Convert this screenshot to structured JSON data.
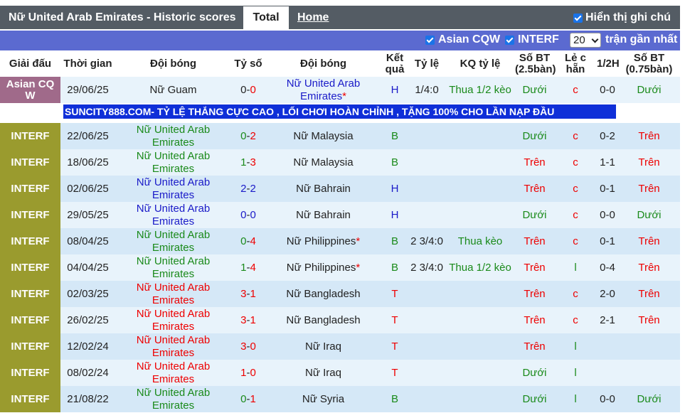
{
  "header": {
    "title": "Nữ United Arab Emirates - Historic scores",
    "tab_total": "Total",
    "tab_home": "Home",
    "show_note_label": "Hiển thị ghi chú"
  },
  "filters": {
    "asian_label": "Asian CQW",
    "interf_label": "INTERF",
    "count_value": "20",
    "count_suffix": "trận gần nhất"
  },
  "columns": [
    "Giải đấu",
    "Thời gian",
    "Đội bóng",
    "Tỷ số",
    "Đội bóng",
    "Kết quả",
    "Tỷ lệ",
    "KQ tỷ lệ",
    "Số BT (2.5bàn)",
    "Lẻ c hẵn",
    "1/2H",
    "Số BT (0.75bàn)"
  ],
  "ad_text": "SUNCITY888.COM- TỶ LỆ THẮNG CỰC CAO , LỐI CHƠI HOÀN CHỈNH , TẶNG 100% CHO LẦN NẠP ĐẦU",
  "colors": {
    "league_asian": "#a06a8a",
    "league_interf": "#9a9b2e",
    "row_light": "#e8f3fb",
    "row_dark": "#d5e8f7",
    "green": "#1a8a1a",
    "red": "#e00000",
    "blue": "#1a1ac8"
  },
  "rows": [
    {
      "league": "Asian CQ W",
      "league_type": "asian",
      "date": "29/06/25",
      "home": "Nữ Guam",
      "home_color": "black",
      "score_a": "0",
      "score_b": "0",
      "away": "Nữ United Arab Emirates",
      "away_color": "blue",
      "away_star": "*",
      "result": "H",
      "result_color": "blue",
      "odds": "1/4:0",
      "odds_result": "Thua 1/2 kèo",
      "ou": "Dưới",
      "ou_color": "green",
      "oe": "c",
      "oe_color": "red",
      "half": "0-0",
      "ou2": "Dưới",
      "ou2_color": "green",
      "ad_after": true
    },
    {
      "league": "INTERF",
      "league_type": "interf",
      "date": "22/06/25",
      "home": "Nữ United Arab Emirates",
      "home_color": "green",
      "score_a": "0",
      "score_b": "2",
      "away": "Nữ Malaysia",
      "away_color": "black",
      "away_star": "",
      "result": "B",
      "result_color": "green",
      "odds": "",
      "odds_result": "",
      "ou": "Dưới",
      "ou_color": "green",
      "oe": "c",
      "oe_color": "red",
      "half": "0-2",
      "ou2": "Trên",
      "ou2_color": "red"
    },
    {
      "league": "INTERF",
      "league_type": "interf",
      "date": "18/06/25",
      "home": "Nữ United Arab Emirates",
      "home_color": "green",
      "score_a": "1",
      "score_b": "3",
      "away": "Nữ Malaysia",
      "away_color": "black",
      "away_star": "",
      "result": "B",
      "result_color": "green",
      "odds": "",
      "odds_result": "",
      "ou": "Trên",
      "ou_color": "red",
      "oe": "c",
      "oe_color": "red",
      "half": "1-1",
      "ou2": "Trên",
      "ou2_color": "red"
    },
    {
      "league": "INTERF",
      "league_type": "interf",
      "date": "02/06/25",
      "home": "Nữ United Arab Emirates",
      "home_color": "blue",
      "score_a": "2",
      "score_b": "2",
      "away": "Nữ Bahrain",
      "away_color": "black",
      "away_star": "",
      "result": "H",
      "result_color": "blue",
      "odds": "",
      "odds_result": "",
      "ou": "Trên",
      "ou_color": "red",
      "oe": "c",
      "oe_color": "red",
      "half": "0-1",
      "ou2": "Trên",
      "ou2_color": "red"
    },
    {
      "league": "INTERF",
      "league_type": "interf",
      "date": "29/05/25",
      "home": "Nữ United Arab Emirates",
      "home_color": "blue",
      "score_a": "0",
      "score_b": "0",
      "away": "Nữ Bahrain",
      "away_color": "black",
      "away_star": "",
      "result": "H",
      "result_color": "blue",
      "odds": "",
      "odds_result": "",
      "ou": "Dưới",
      "ou_color": "green",
      "oe": "c",
      "oe_color": "red",
      "half": "0-0",
      "ou2": "Dưới",
      "ou2_color": "green"
    },
    {
      "league": "INTERF",
      "league_type": "interf",
      "date": "08/04/25",
      "home": "Nữ United Arab Emirates",
      "home_color": "green",
      "score_a": "0",
      "score_b": "4",
      "away": "Nữ Philippines",
      "away_color": "black",
      "away_star": "*",
      "result": "B",
      "result_color": "green",
      "odds": "2 3/4:0",
      "odds_result": "Thua kèo",
      "ou": "Trên",
      "ou_color": "red",
      "oe": "c",
      "oe_color": "red",
      "half": "0-1",
      "ou2": "Trên",
      "ou2_color": "red"
    },
    {
      "league": "INTERF",
      "league_type": "interf",
      "date": "04/04/25",
      "home": "Nữ United Arab Emirates",
      "home_color": "green",
      "score_a": "1",
      "score_b": "4",
      "away": "Nữ Philippines",
      "away_color": "black",
      "away_star": "*",
      "result": "B",
      "result_color": "green",
      "odds": "2 3/4:0",
      "odds_result": "Thua 1/2 kèo",
      "ou": "Trên",
      "ou_color": "red",
      "oe": "l",
      "oe_color": "green",
      "half": "0-4",
      "ou2": "Trên",
      "ou2_color": "red"
    },
    {
      "league": "INTERF",
      "league_type": "interf",
      "date": "02/03/25",
      "home": "Nữ United Arab Emirates",
      "home_color": "red",
      "score_a": "3",
      "score_b": "1",
      "away": "Nữ Bangladesh",
      "away_color": "black",
      "away_star": "",
      "result": "T",
      "result_color": "red",
      "odds": "",
      "odds_result": "",
      "ou": "Trên",
      "ou_color": "red",
      "oe": "c",
      "oe_color": "red",
      "half": "2-0",
      "ou2": "Trên",
      "ou2_color": "red"
    },
    {
      "league": "INTERF",
      "league_type": "interf",
      "date": "26/02/25",
      "home": "Nữ United Arab Emirates",
      "home_color": "red",
      "score_a": "3",
      "score_b": "1",
      "away": "Nữ Bangladesh",
      "away_color": "black",
      "away_star": "",
      "result": "T",
      "result_color": "red",
      "odds": "",
      "odds_result": "",
      "ou": "Trên",
      "ou_color": "red",
      "oe": "c",
      "oe_color": "red",
      "half": "2-1",
      "ou2": "Trên",
      "ou2_color": "red"
    },
    {
      "league": "INTERF",
      "league_type": "interf",
      "date": "12/02/24",
      "home": "Nữ United Arab Emirates",
      "home_color": "red",
      "score_a": "3",
      "score_b": "0",
      "away": "Nữ Iraq",
      "away_color": "black",
      "away_star": "",
      "result": "T",
      "result_color": "red",
      "odds": "",
      "odds_result": "",
      "ou": "Trên",
      "ou_color": "red",
      "oe": "l",
      "oe_color": "green",
      "half": "",
      "ou2": "",
      "ou2_color": "red"
    },
    {
      "league": "INTERF",
      "league_type": "interf",
      "date": "08/02/24",
      "home": "Nữ United Arab Emirates",
      "home_color": "red",
      "score_a": "1",
      "score_b": "0",
      "away": "Nữ Iraq",
      "away_color": "black",
      "away_star": "",
      "result": "T",
      "result_color": "red",
      "odds": "",
      "odds_result": "",
      "ou": "Dưới",
      "ou_color": "green",
      "oe": "l",
      "oe_color": "green",
      "half": "",
      "ou2": "",
      "ou2_color": "red"
    },
    {
      "league": "INTERF",
      "league_type": "interf",
      "date": "21/08/22",
      "home": "Nữ United Arab Emirates",
      "home_color": "green",
      "score_a": "0",
      "score_b": "1",
      "away": "Nữ Syria",
      "away_color": "black",
      "away_star": "",
      "result": "B",
      "result_color": "green",
      "odds": "",
      "odds_result": "",
      "ou": "Dưới",
      "ou_color": "green",
      "oe": "l",
      "oe_color": "green",
      "half": "0-0",
      "ou2": "Dưới",
      "ou2_color": "green"
    }
  ]
}
